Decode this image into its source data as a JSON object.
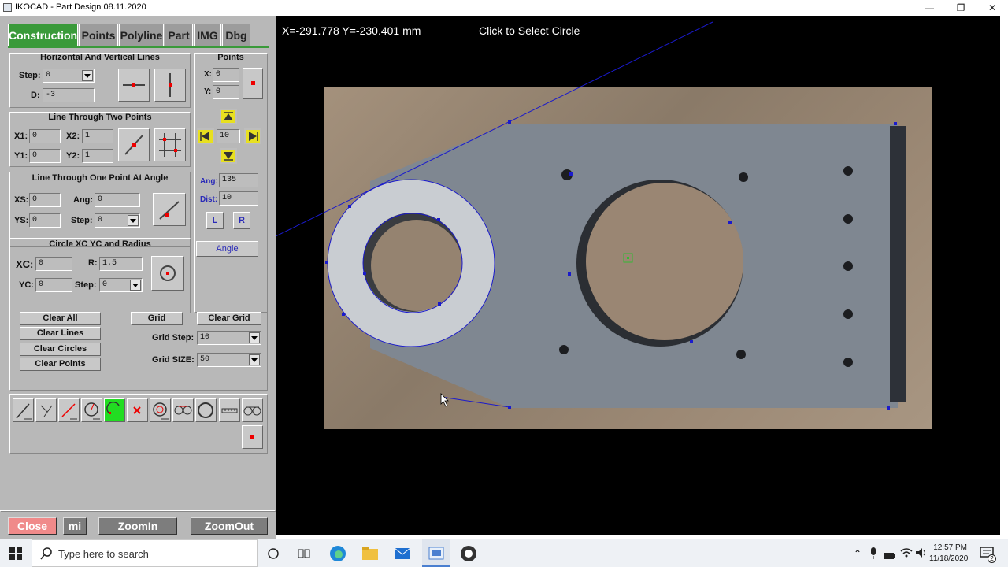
{
  "window": {
    "title": "IKOCAD - Part Design 08.11.2020"
  },
  "tabs": [
    "Construction",
    "Points",
    "Polyline",
    "Part",
    "IMG",
    "Dbg"
  ],
  "hv_lines": {
    "title": "Horizontal And Vertical Lines",
    "step_label": "Step:",
    "step_value": "0",
    "d_label": "D:",
    "d_value": "-3"
  },
  "points": {
    "title": "Points",
    "x_label": "X:",
    "x_value": "0",
    "y_label": "Y:",
    "y_value": "0",
    "step_value": "10",
    "ang_label": "Ang:",
    "ang_value": "135",
    "dist_label": "Dist:",
    "dist_value": "10",
    "l_label": "L",
    "r_label": "R",
    "angle_label": "Angle"
  },
  "two_points": {
    "title": "Line Through Two Points",
    "x1_label": "X1:",
    "x1_value": "0",
    "x2_label": "X2:",
    "x2_value": "1",
    "y1_label": "Y1:",
    "y1_value": "0",
    "y2_label": "Y2:",
    "y2_value": "1"
  },
  "one_point": {
    "title": "Line Through One Point At Angle",
    "xs_label": "XS:",
    "xs_value": "0",
    "ang_label": "Ang:",
    "ang_value": "0",
    "ys_label": "YS:",
    "ys_value": "0",
    "step_label": "Step:",
    "step_value": "0"
  },
  "circle": {
    "title": "Circle XC YC and Radius",
    "xc_label": "XC:",
    "xc_value": "0",
    "r_label": "R:",
    "r_value": "1.5",
    "yc_label": "YC:",
    "yc_value": "0",
    "step_label": "Step:",
    "step_value": "0"
  },
  "clear": {
    "clear_all": "Clear All",
    "clear_lines": "Clear Lines",
    "clear_circles": "Clear Circles",
    "clear_points": "Clear Points",
    "grid": "Grid",
    "clear_grid": "Clear Grid",
    "grid_step_label": "Grid Step:",
    "grid_step_value": "10",
    "grid_size_label": "Grid SIZE:",
    "grid_size_value": "50"
  },
  "bottom": {
    "close": "Close",
    "mi": "mi",
    "zoom_in": "ZoomIn",
    "zoom_out": "ZoomOut"
  },
  "canvas": {
    "coords": "X=-291.778 Y=-230.401 mm",
    "status": "Click to Select Circle"
  },
  "taskbar": {
    "search_placeholder": "Type here to search",
    "time": "12:57 PM",
    "date": "11/18/2020",
    "notifications": "2"
  },
  "colors": {
    "active_tab": "#3a9a3a",
    "close_button": "#f08a8a",
    "cad_blue": "#1a1acc",
    "tool_active": "#22dd22"
  }
}
